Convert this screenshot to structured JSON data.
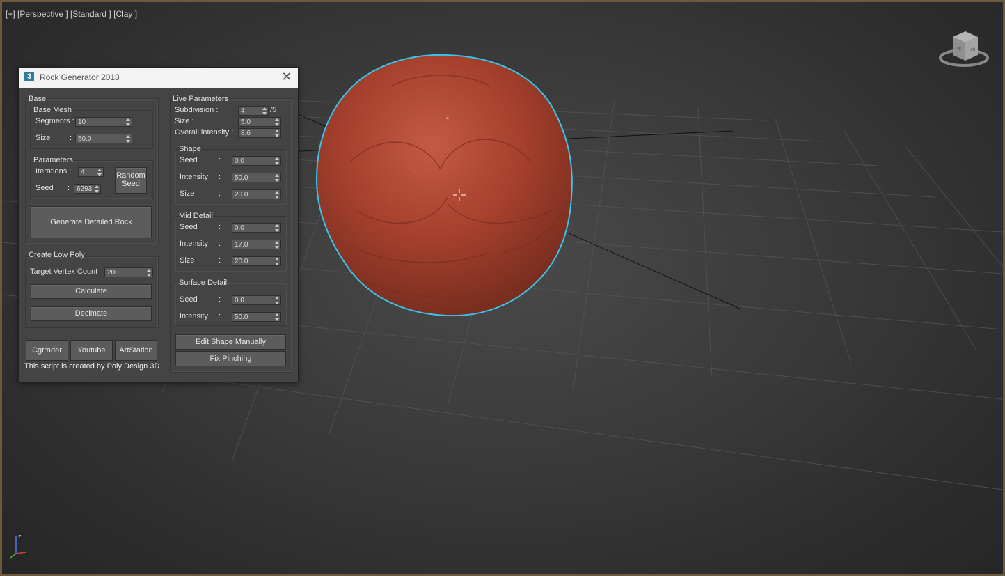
{
  "viewport": {
    "label": "[+] [Perspective ] [Standard ] [Clay ]",
    "viewcube_face_left": "top",
    "viewcube_face_right": "left",
    "axis_z": "z",
    "selection_color": "#3ac4ec",
    "rock_color": "#b0432f"
  },
  "dialog": {
    "app_icon": "3",
    "title": "Rock Generator 2018",
    "close": "✕",
    "base": {
      "label": "Base",
      "base_mesh": {
        "label": "Base Mesh",
        "segments_label": "Segments :",
        "segments_value": "10",
        "size_label": "Size",
        "size_colon": ":",
        "size_value": "50.0"
      },
      "parameters": {
        "label": "Parameters",
        "iterations_label": "Iterations :",
        "iterations_value": "4",
        "seed_label": "Seed",
        "seed_colon": ":",
        "seed_value": "6293",
        "random_seed_line1": "Random",
        "random_seed_line2": "Seed"
      },
      "generate_label": "Generate Detailed Rock"
    },
    "low_poly": {
      "label": "Create Low Poly",
      "target_label": "Target Vertex Count",
      "target_value": "200",
      "calculate_label": "Calculate",
      "decimate_label": "Decimate"
    },
    "links": {
      "cgtrader": "Cgtrader",
      "youtube": "Youtube",
      "artstation": "ArtStation"
    },
    "footer": "This script is created by Poly Design 3D",
    "live": {
      "label": "Live Parameters",
      "subdivision_label": "Subdivision :",
      "subdivision_value": "4",
      "subdivision_max": "/5",
      "size_label": "Size :",
      "size_value": "5.0",
      "overall_label": "Overall intensity :",
      "overall_value": "8.6",
      "shape": {
        "label": "Shape",
        "seed_label": "Seed",
        "seed_value": "0.0",
        "intensity_label": "Intensity",
        "intensity_value": "50.0",
        "size_label": "Size",
        "size_value": "20.0"
      },
      "mid": {
        "label": "Mid Detail",
        "seed_label": "Seed",
        "seed_value": "0.0",
        "intensity_label": "Intensity",
        "intensity_value": "17.0",
        "size_label": "Size",
        "size_value": "20.0"
      },
      "surface": {
        "label": "Surface Detail",
        "seed_label": "Seed",
        "seed_value": "0.0",
        "intensity_label": "Intensity",
        "intensity_value": "50.0"
      },
      "colon": ":",
      "edit_label": "Edit Shape Manually",
      "fix_label": "Fix Pinching"
    }
  }
}
